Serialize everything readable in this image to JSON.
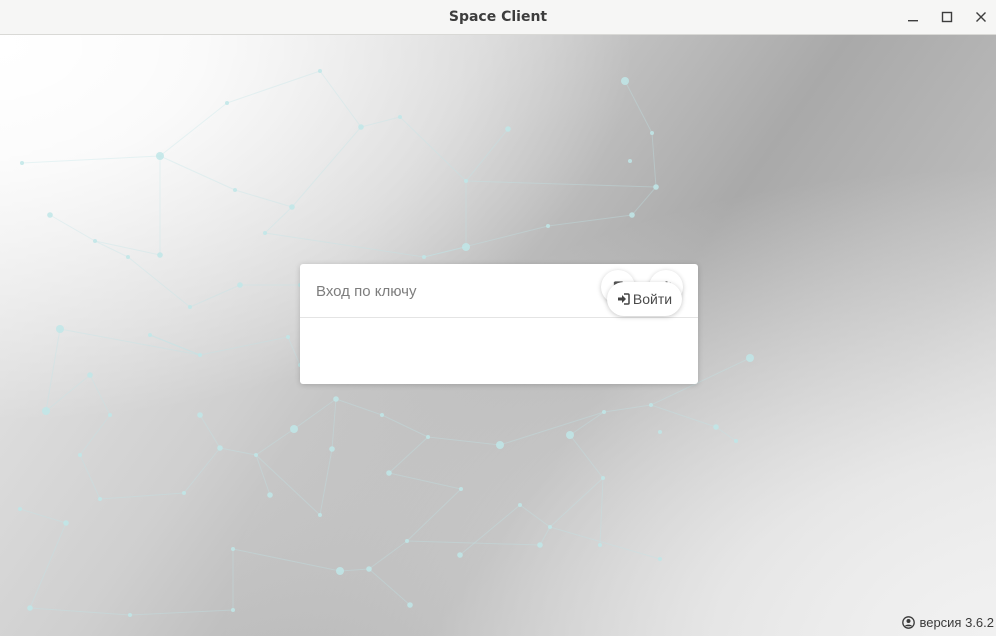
{
  "window": {
    "title": "Space Client"
  },
  "login": {
    "key_placeholder": "Вход по ключу",
    "key_value": "",
    "login_label": "Войти"
  },
  "footer": {
    "version_text": "версия 3.6.2"
  },
  "icons": {
    "minimize": "minimize-icon",
    "maximize": "maximize-icon",
    "close": "close-icon",
    "book": "book-icon",
    "settings": "gear-icon",
    "sign_in": "sign-in-icon",
    "user": "user-circle-icon"
  },
  "colors": {
    "titlebar": "#f6f6f5",
    "network_nodes": "#bfe6e8",
    "card": "#ffffff"
  }
}
